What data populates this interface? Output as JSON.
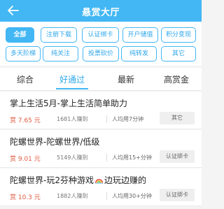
{
  "header": {
    "title": "悬赏大厅"
  },
  "filters": [
    "全部",
    "注册下载",
    "认证绑卡",
    "开户储值",
    "积分变现",
    "多天阶梯",
    "纯关注",
    "投票砍价",
    "纯转发",
    "其它"
  ],
  "tabs": [
    "综合",
    "好通过",
    "最新",
    "高赏金"
  ],
  "tasks": [
    {
      "title": "掌上生活5月-掌上生活简单助力",
      "price": "赏 7.65 元",
      "stats": "1681人赚到",
      "time": "人均用7分钟",
      "tag": "其它"
    },
    {
      "title": "陀螺世界-陀螺世界/低级",
      "price": "赏 9.01 元",
      "stats": "5149人赚到",
      "time": "人均用15+分钟",
      "tag": "认证绑卡"
    },
    {
      "title_before": "陀螺世界-玩2芬种游戏",
      "title_after": "边玩边赚的",
      "price": "赏 10.3 元",
      "stats": "1882人赚到",
      "time": "人均用30+分钟",
      "tag": "认证绑卡"
    }
  ]
}
